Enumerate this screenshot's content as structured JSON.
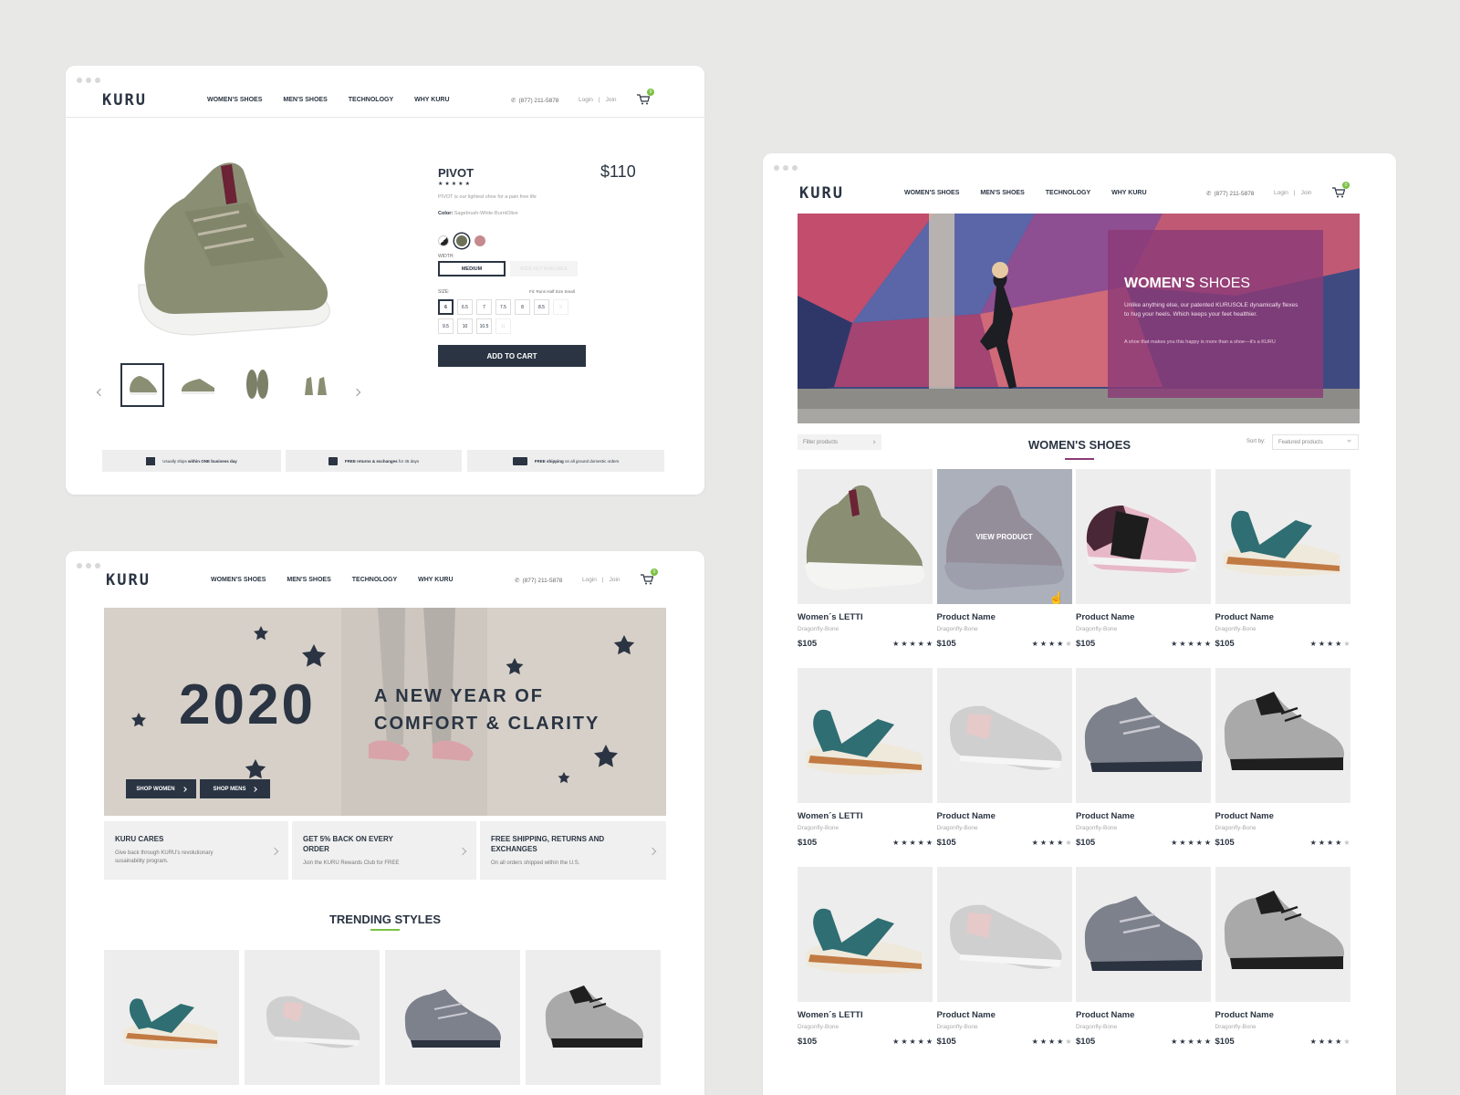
{
  "brand": "KURU",
  "nav": {
    "links": [
      "WOMEN'S SHOES",
      "MEN'S SHOES",
      "TECHNOLOGY",
      "WHY KURU"
    ],
    "phone": "(877) 211-5878",
    "login": "Login",
    "join": "Join",
    "cart_count": "0"
  },
  "colors": {
    "navy": "#2a3442",
    "accent_green": "#7ac143",
    "hero_purple": "#8b3a78"
  },
  "product_page": {
    "name": "PIVOT",
    "price": "$110",
    "rating": 5,
    "tagline": "PIVOT is our lightest shoe for a pain free life",
    "color_label": "Color:",
    "color_value": "Sagebrush-White-BurntOlive",
    "width_label": "WIDTH:",
    "width_selected": "MEDIUM",
    "width_unavailable": "WIDE NOT AVAILABLE",
    "size_label": "SIZE:",
    "fit_label": "Fit:",
    "fit_value": "Runs Half Size Small",
    "sizes_row1": [
      "6",
      "6.5",
      "7",
      "7.5",
      "8",
      "8.5",
      "9"
    ],
    "sizes_row2": [
      "9.5",
      "10",
      "10.5",
      "11"
    ],
    "add_to_cart": "ADD TO CART",
    "benefits": [
      {
        "pre": "Usually ships ",
        "bold": "within ONE business day",
        "post": "",
        "icon": "box-icon"
      },
      {
        "pre": "",
        "bold": "FREE returns & exchanges",
        "post": " for 45 days",
        "icon": "return-box-icon"
      },
      {
        "pre": "",
        "bold": "FREE shipping",
        "post": " on all ground domestic orders",
        "icon": "truck-icon"
      }
    ]
  },
  "home_page": {
    "hero_year": "2020",
    "hero_line1": "A NEW YEAR OF",
    "hero_line2": "COMFORT & CLARITY",
    "shop_women": "SHOP WOMEN",
    "shop_mens": "SHOP MENS",
    "promos": [
      {
        "title": "KURU CARES",
        "text": "Give back through KURU's revolutionary susainability program."
      },
      {
        "title": "GET 5% BACK ON EVERY ORDER",
        "text": "Join the KURU Rewards Club for FREE"
      },
      {
        "title": "FREE SHIPPING, RETURNS AND EXCHANGES",
        "text": "On all orders shipped within the U.S."
      }
    ],
    "trending_title": "TRENDING STYLES"
  },
  "listing_page": {
    "hero_title_bold": "WOMEN'S",
    "hero_title_light": " SHOES",
    "hero_text": "Unlike anything else, our patented KURUSOLE dynamically flexes to hug your heels. Which keeps your feet healthier.",
    "hero_subtext": "A shoe that makes you this happy is more than a shoe—it's a KURU",
    "filter_placeholder": "Filter products",
    "section_title": "WOMEN'S SHOES",
    "sort_label": "Sort by:",
    "sort_value": "Featured products",
    "view_product": "VIEW PRODUCT",
    "products": [
      {
        "name": "Women´s LETTI",
        "sub": "Dragonfly-Bone",
        "price": "$105",
        "rating": 5,
        "shoe": "green-sneaker"
      },
      {
        "name": "Product Name",
        "sub": "Dragonfly-Bone",
        "price": "$105",
        "rating": 4,
        "shoe": "pink-sneaker"
      },
      {
        "name": "Product Name",
        "sub": "Dragonfly-Bone",
        "price": "$105",
        "rating": 5,
        "shoe": "plum-slipon"
      },
      {
        "name": "Product Name",
        "sub": "Dragonfly-Bone",
        "price": "$105",
        "rating": 4,
        "shoe": "teal-sandal"
      },
      {
        "name": "Women´s LETTI",
        "sub": "Dragonfly-Bone",
        "price": "$105",
        "rating": 5,
        "shoe": "teal-sandal"
      },
      {
        "name": "Product Name",
        "sub": "Dragonfly-Bone",
        "price": "$105",
        "rating": 4,
        "shoe": "grey-slipon"
      },
      {
        "name": "Product Name",
        "sub": "Dragonfly-Bone",
        "price": "$105",
        "rating": 5,
        "shoe": "grey-sneaker"
      },
      {
        "name": "Product Name",
        "sub": "Dragonfly-Bone",
        "price": "$105",
        "rating": 4,
        "shoe": "black-sneaker"
      },
      {
        "name": "Women´s LETTI",
        "sub": "Dragonfly-Bone",
        "price": "$105",
        "rating": 5,
        "shoe": "teal-sandal"
      },
      {
        "name": "Product Name",
        "sub": "Dragonfly-Bone",
        "price": "$105",
        "rating": 4,
        "shoe": "grey-slipon"
      },
      {
        "name": "Product Name",
        "sub": "Dragonfly-Bone",
        "price": "$105",
        "rating": 5,
        "shoe": "grey-sneaker"
      },
      {
        "name": "Product Name",
        "sub": "Dragonfly-Bone",
        "price": "$105",
        "rating": 4,
        "shoe": "black-sneaker"
      }
    ]
  }
}
